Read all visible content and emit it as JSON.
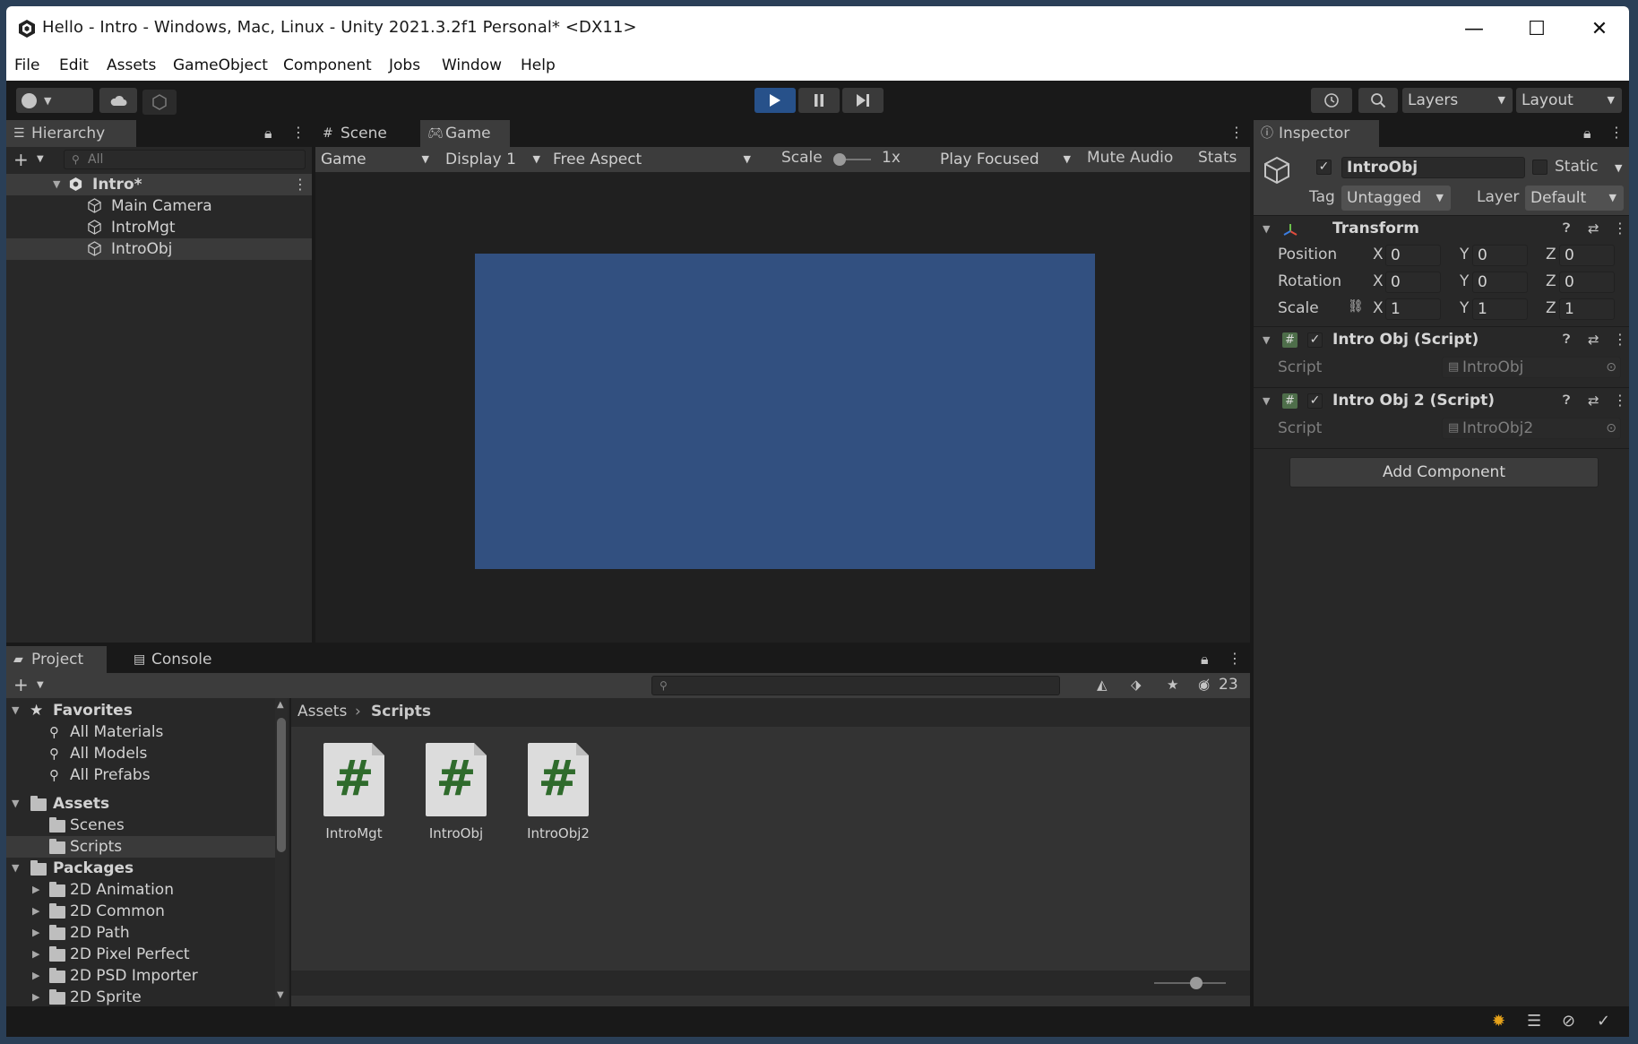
{
  "window": {
    "title": "Hello - Intro - Windows, Mac, Linux - Unity 2021.3.2f1 Personal* <DX11>",
    "minimize": "—",
    "maximize": "☐",
    "close": "✕"
  },
  "menu": [
    "File",
    "Edit",
    "Assets",
    "GameObject",
    "Component",
    "Jobs",
    "Window",
    "Help"
  ],
  "toolbar": {
    "layers_label": "Layers",
    "layout_label": "Layout"
  },
  "hierarchy": {
    "tab": "Hierarchy",
    "search_placeholder": "All",
    "scene": "Intro*",
    "items": [
      "Main Camera",
      "IntroMgt",
      "IntroObj"
    ],
    "selected": "IntroObj"
  },
  "scene_tabs": {
    "scene": "Scene",
    "game": "Game"
  },
  "game_bar": {
    "mode": "Game",
    "display": "Display 1",
    "aspect": "Free Aspect",
    "scale_label": "Scale",
    "scale_value": "1x",
    "play_focused": "Play Focused",
    "mute_audio": "Mute Audio",
    "stats": "Stats"
  },
  "colors": {
    "game_view": "#325080",
    "accent_play": "#27518a"
  },
  "inspector": {
    "tab": "Inspector",
    "object_name": "IntroObj",
    "static_label": "Static",
    "tag_label": "Tag",
    "tag_value": "Untagged",
    "layer_label": "Layer",
    "layer_value": "Default",
    "transform": {
      "title": "Transform",
      "rows": [
        {
          "label": "Position",
          "x": "0",
          "y": "0",
          "z": "0"
        },
        {
          "label": "Rotation",
          "x": "0",
          "y": "0",
          "z": "0"
        },
        {
          "label": "Scale",
          "x": "1",
          "y": "1",
          "z": "1"
        }
      ],
      "axis_x": "X",
      "axis_y": "Y",
      "axis_z": "Z"
    },
    "components": [
      {
        "title": "Intro Obj (Script)",
        "field_label": "Script",
        "field_value": "IntroObj"
      },
      {
        "title": "Intro Obj 2 (Script)",
        "field_label": "Script",
        "field_value": "IntroObj2"
      }
    ],
    "add_component": "Add Component"
  },
  "project": {
    "tab_project": "Project",
    "tab_console": "Console",
    "hidden_count": "23",
    "breadcrumb": [
      "Assets",
      "Scripts"
    ],
    "favorites_label": "Favorites",
    "favorites": [
      "All Materials",
      "All Models",
      "All Prefabs"
    ],
    "assets_label": "Assets",
    "assets_children": [
      "Scenes",
      "Scripts"
    ],
    "packages_label": "Packages",
    "packages": [
      "2D Animation",
      "2D Common",
      "2D Path",
      "2D Pixel Perfect",
      "2D PSD Importer",
      "2D Sprite"
    ],
    "files": [
      {
        "name": "IntroMgt",
        "glyph": "#"
      },
      {
        "name": "IntroObj",
        "glyph": "#"
      },
      {
        "name": "IntroObj2",
        "glyph": "#"
      }
    ]
  }
}
